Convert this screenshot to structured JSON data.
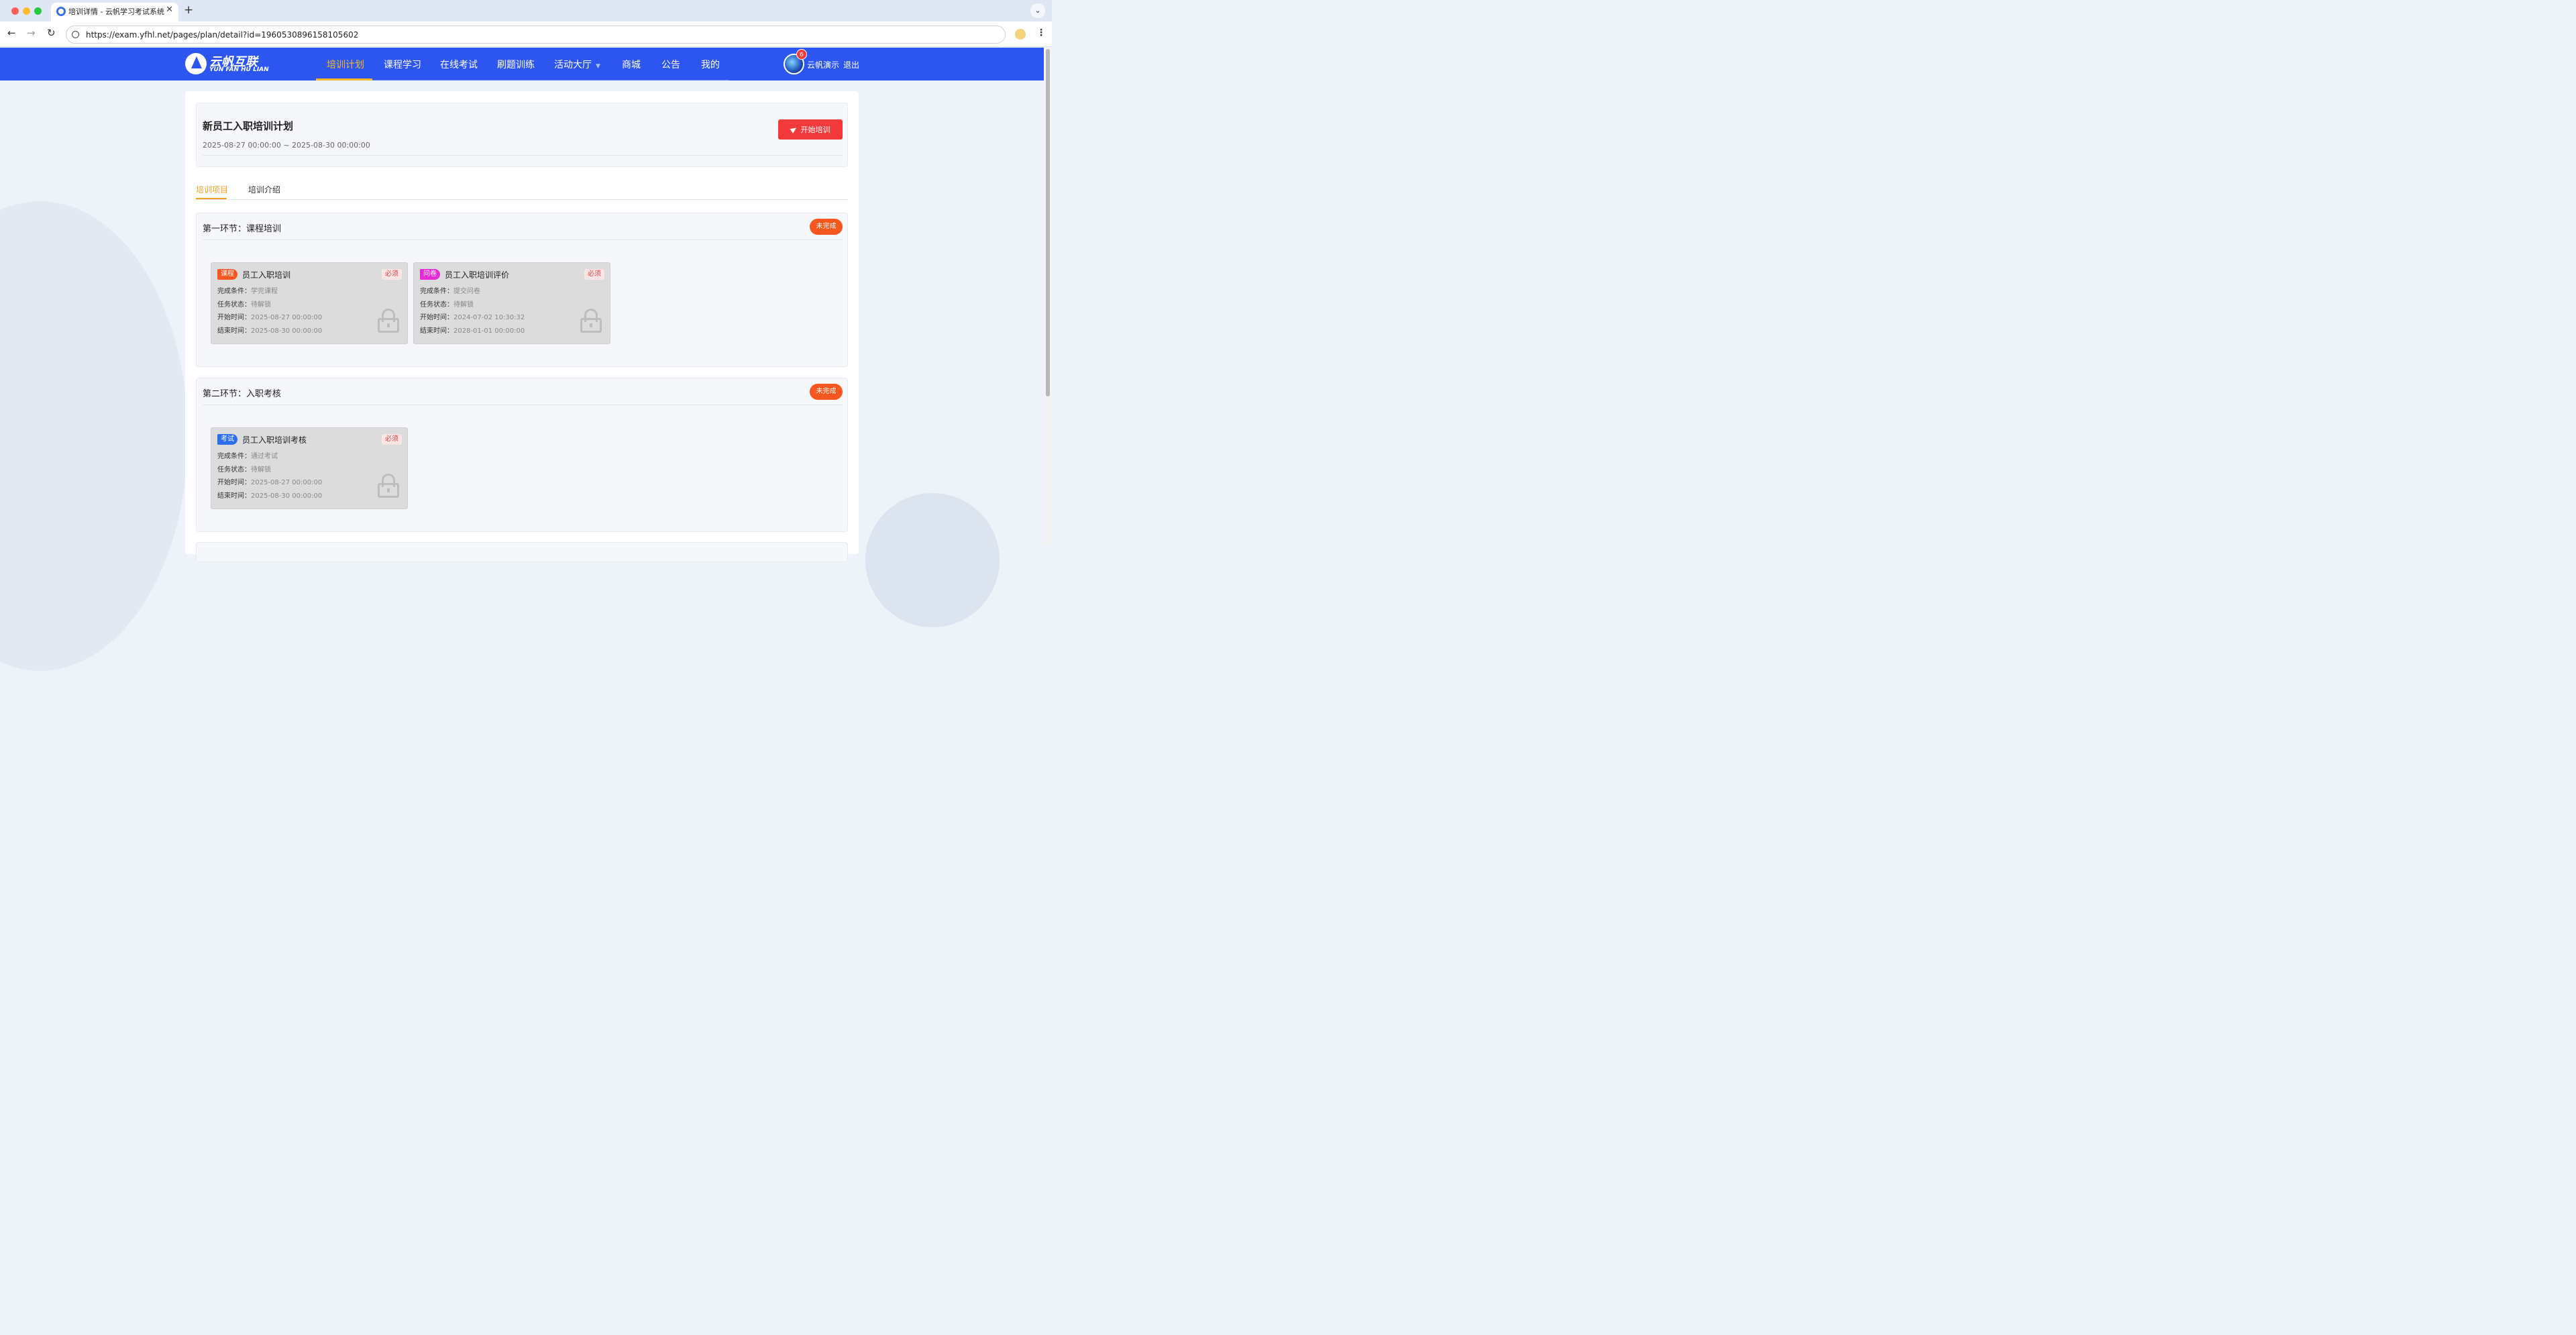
{
  "browser": {
    "tab_title": "培训详情 - 云帆学习考试系统",
    "url": "https://exam.yfhl.net/pages/plan/detail?id=1960530896158105602",
    "traffic_colors": [
      "#ff5f57",
      "#febc2e",
      "#28c840"
    ]
  },
  "header": {
    "logo_cn": "云帆互联",
    "logo_en": "YUN FAN HU LIAN",
    "menu": [
      "培训计划",
      "课程学习",
      "在线考试",
      "刷题训练",
      "活动大厅",
      "商城",
      "公告",
      "我的"
    ],
    "active_menu": "培训计划",
    "notification_count": "6",
    "user_name": "云帆演示",
    "logout": "退出",
    "brand_color": "#2d56f0",
    "active_color": "#f7b928"
  },
  "plan": {
    "title": "新员工入职培训计划",
    "date_range": "2025-08-27 00:00:00 ~ 2025-08-30 00:00:00",
    "start_button": "开始培训"
  },
  "tabs": [
    "培训项目",
    "培训介绍"
  ],
  "labels": {
    "condition": "完成条件：",
    "status": "任务状态：",
    "start": "开始时间：",
    "end": "结束时间："
  },
  "stages": [
    {
      "title": "第一环节：课程培训",
      "status": "未完成",
      "tasks": [
        {
          "tag": "课程",
          "tag_color": "#f5571f",
          "name": "员工入职培训",
          "required": "必须",
          "condition": "学完课程",
          "status": "待解锁",
          "start": "2025-08-27 00:00:00",
          "end": "2025-08-30 00:00:00"
        },
        {
          "tag": "问卷",
          "tag_color": "#e829d6",
          "name": "员工入职培训评价",
          "required": "必须",
          "condition": "提交问卷",
          "status": "待解锁",
          "start": "2024-07-02 10:30:32",
          "end": "2028-01-01 00:00:00"
        }
      ]
    },
    {
      "title": "第二环节：入职考核",
      "status": "未完成",
      "tasks": [
        {
          "tag": "考试",
          "tag_color": "#2d6ef0",
          "name": "员工入职培训考核",
          "required": "必须",
          "condition": "通过考试",
          "status": "待解锁",
          "start": "2025-08-27 00:00:00",
          "end": "2025-08-30 00:00:00"
        }
      ]
    }
  ]
}
